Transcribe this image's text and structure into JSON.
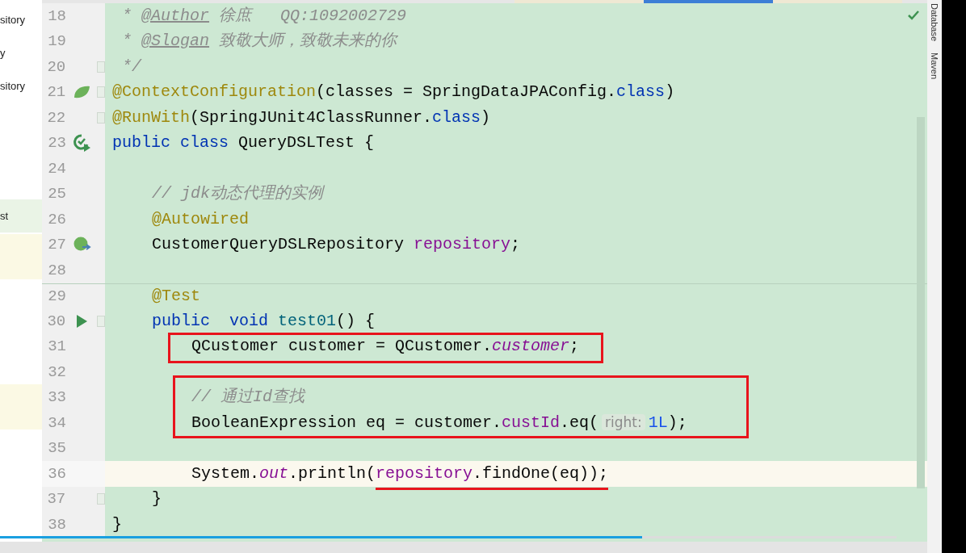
{
  "editor_tabs": [
    {
      "selected": false
    },
    {
      "selected": true
    },
    {
      "selected": false
    }
  ],
  "sidebar": {
    "items": [
      {
        "label": "sitory"
      },
      {
        "label": "y"
      },
      {
        "label": "sitory"
      },
      {
        "label": "st"
      }
    ]
  },
  "editor": {
    "lines": [
      {
        "kind": "line",
        "number": "18",
        "fold": false,
        "current": false,
        "separator": false,
        "tokens": [
          {
            "kind": "comment",
            "text": " * "
          },
          {
            "kind": "doctag",
            "text": "@Author"
          },
          {
            "kind": "comment",
            "text": " 徐庶   QQ:1092002729"
          }
        ]
      },
      {
        "kind": "line",
        "number": "19",
        "fold": false,
        "current": false,
        "separator": false,
        "tokens": [
          {
            "kind": "comment",
            "text": " * "
          },
          {
            "kind": "doctag",
            "text": "@Slogan"
          },
          {
            "kind": "comment",
            "text": " 致敬大师，致敬未来的你"
          }
        ]
      },
      {
        "kind": "line",
        "number": "20",
        "fold": true,
        "current": false,
        "separator": false,
        "tokens": [
          {
            "kind": "comment",
            "text": " */"
          }
        ]
      },
      {
        "kind": "line",
        "number": "21",
        "gutter_icon": {
          "kind": "spring"
        },
        "fold": true,
        "current": false,
        "separator": false,
        "tokens": [
          {
            "kind": "annotation",
            "text": "@ContextConfiguration"
          },
          {
            "kind": "plain",
            "text": "(classes = SpringDataJPAConfig."
          },
          {
            "kind": "keyword",
            "text": "class"
          },
          {
            "kind": "plain",
            "text": ")"
          }
        ]
      },
      {
        "kind": "line",
        "number": "22",
        "fold": true,
        "current": false,
        "separator": false,
        "tokens": [
          {
            "kind": "annotation",
            "text": "@RunWith"
          },
          {
            "kind": "plain",
            "text": "(SpringJUnit4ClassRunner."
          },
          {
            "kind": "keyword",
            "text": "class"
          },
          {
            "kind": "plain",
            "text": ")"
          }
        ]
      },
      {
        "kind": "line",
        "number": "23",
        "gutter_icon": {
          "kind": "run-class"
        },
        "fold": false,
        "current": false,
        "separator": false,
        "tokens": [
          {
            "kind": "keyword",
            "text": "public class"
          },
          {
            "kind": "plain",
            "text": " QueryDSLTest {"
          }
        ],
        "children": [
          {
            "kind": "line",
            "number": "24",
            "fold": false,
            "current": false,
            "separator": false
          },
          {
            "kind": "line",
            "number": "25",
            "fold": false,
            "current": false,
            "separator": false,
            "tokens": [
              {
                "kind": "comment",
                "text": "// jdk动态代理的实例"
              }
            ]
          },
          {
            "kind": "line",
            "number": "26",
            "fold": false,
            "current": false,
            "separator": false,
            "tokens": [
              {
                "kind": "annotation",
                "text": "@Autowired"
              }
            ]
          },
          {
            "kind": "line",
            "number": "27",
            "gutter_icon": {
              "kind": "bean"
            },
            "fold": false,
            "current": false,
            "separator": false,
            "tokens": [
              {
                "kind": "plain",
                "text": "CustomerQueryDSLRepository "
              },
              {
                "kind": "field",
                "text": "repository"
              },
              {
                "kind": "plain",
                "text": ";"
              }
            ]
          },
          {
            "kind": "line",
            "number": "28",
            "fold": false,
            "current": false,
            "separator": false
          },
          {
            "kind": "line",
            "number": "29",
            "fold": false,
            "current": false,
            "separator": true,
            "tokens": [
              {
                "kind": "annotation",
                "text": "@Test"
              }
            ]
          },
          {
            "kind": "line",
            "number": "30",
            "gutter_icon": {
              "kind": "run"
            },
            "fold": true,
            "current": false,
            "separator": false,
            "tokens": [
              {
                "kind": "keyword",
                "text": "public  void"
              },
              {
                "kind": "method",
                "text": " test01"
              },
              {
                "kind": "plain",
                "text": "() {"
              }
            ],
            "children": [
              {
                "kind": "boxed",
                "children": [
                  {
                    "kind": "line",
                    "number": "31",
                    "fold": false,
                    "current": false,
                    "separator": false,
                    "tokens": [
                      {
                        "kind": "plain",
                        "text": "QCustomer customer = QCustomer."
                      },
                      {
                        "kind": "static",
                        "text": "customer"
                      },
                      {
                        "kind": "plain",
                        "text": ";"
                      }
                    ]
                  }
                ]
              },
              {
                "kind": "line",
                "number": "32",
                "fold": false,
                "current": false,
                "separator": false
              },
              {
                "kind": "boxed",
                "children": [
                  {
                    "kind": "line",
                    "number": "33",
                    "fold": false,
                    "current": false,
                    "separator": false,
                    "tokens": [
                      {
                        "kind": "comment",
                        "text": "// 通过Id查找"
                      }
                    ]
                  },
                  {
                    "kind": "line",
                    "number": "34",
                    "fold": false,
                    "current": false,
                    "separator": false,
                    "tokens": [
                      {
                        "kind": "plain",
                        "text": "BooleanExpression eq = customer."
                      },
                      {
                        "kind": "field",
                        "text": "custId"
                      },
                      {
                        "kind": "plain",
                        "text": ".eq("
                      },
                      {
                        "kind": "hint",
                        "text": "right:"
                      },
                      {
                        "kind": "number",
                        "text": "1L"
                      },
                      {
                        "kind": "plain",
                        "text": ");"
                      }
                    ]
                  }
                ]
              },
              {
                "kind": "line",
                "number": "35",
                "fold": false,
                "current": false,
                "separator": false
              },
              {
                "kind": "line",
                "number": "36",
                "fold": false,
                "current": true,
                "separator": false,
                "tokens": [
                  {
                    "kind": "plain",
                    "text": "System.",
                    "marked": false
                  },
                  {
                    "kind": "static",
                    "text": "out",
                    "marked": false
                  },
                  {
                    "kind": "plain",
                    "text": ".println(",
                    "marked": false
                  },
                  {
                    "kind": "field",
                    "text": "repository",
                    "marked": true
                  },
                  {
                    "kind": "plain",
                    "text": ".findOne(eq));",
                    "marked": true
                  }
                ]
              }
            ]
          },
          {
            "kind": "line",
            "number": "37",
            "fold": true,
            "current": false,
            "separator": false,
            "tokens": [
              {
                "kind": "plain",
                "text": "}"
              }
            ]
          }
        ]
      },
      {
        "kind": "line",
        "number": "38",
        "fold": false,
        "current": false,
        "separator": false,
        "tokens": [
          {
            "kind": "plain",
            "text": "}"
          }
        ]
      }
    ]
  },
  "tool_strip": [
    {
      "label": "Database"
    },
    {
      "label": "Maven"
    }
  ],
  "video_progress": {
    "level": 0.665
  }
}
